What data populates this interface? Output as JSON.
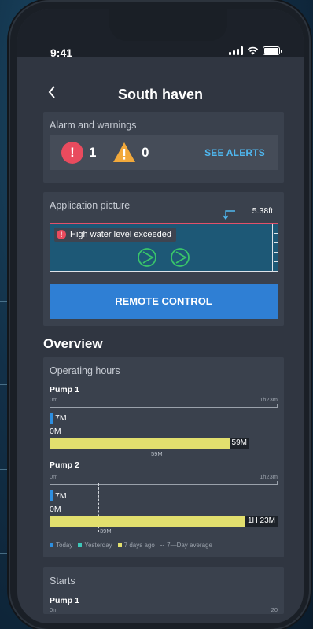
{
  "status": {
    "time": "9:41"
  },
  "header": {
    "back_label": "<",
    "title": "South haven"
  },
  "alarms": {
    "title": "Alarm and warnings",
    "alarm_count": "1",
    "warning_count": "0",
    "see_alerts": "SEE ALERTS",
    "colors": {
      "alarm": "#e94b5e",
      "warning": "#f2a93b",
      "link": "#4fb7ef"
    }
  },
  "application": {
    "title": "Application picture",
    "level": "5.38ft",
    "alert_text": "High water level exceeded",
    "remote_control": "REMOTE CONTROL",
    "pump_icon": "pump-icon",
    "colors": {
      "water": "#1d5876",
      "pump": "#39c46a",
      "button": "#2f7fd4"
    }
  },
  "overview": {
    "title": "Overview"
  },
  "operating_hours": {
    "title": "Operating hours",
    "pumps": [
      {
        "name": "Pump 1",
        "axis_min": "0m",
        "axis_max": "1h23m",
        "today": "7M",
        "yesterday": "0M",
        "seven_days_ago": "59M",
        "average": "59M",
        "fill_fraction": 0.78,
        "avg_fraction": 0.43,
        "today_fraction": 0.08
      },
      {
        "name": "Pump 2",
        "axis_min": "0m",
        "axis_max": "1h23m",
        "today": "7M",
        "yesterday": "0M",
        "seven_days_ago": "1H 23M",
        "average": "39M",
        "fill_fraction": 1.0,
        "avg_fraction": 0.22,
        "today_fraction": 0.08
      }
    ],
    "legend": {
      "today": "Today",
      "yesterday": "Yesterday",
      "seven_days_ago": "7 days ago",
      "average": "7—Day average",
      "colors": {
        "today": "#2e8fe0",
        "yesterday": "#3ec6b8",
        "seven_days_ago": "#e2df6e"
      }
    }
  },
  "starts": {
    "title": "Starts",
    "pump": "Pump 1",
    "axis_min": "0m",
    "axis_max": "20"
  }
}
